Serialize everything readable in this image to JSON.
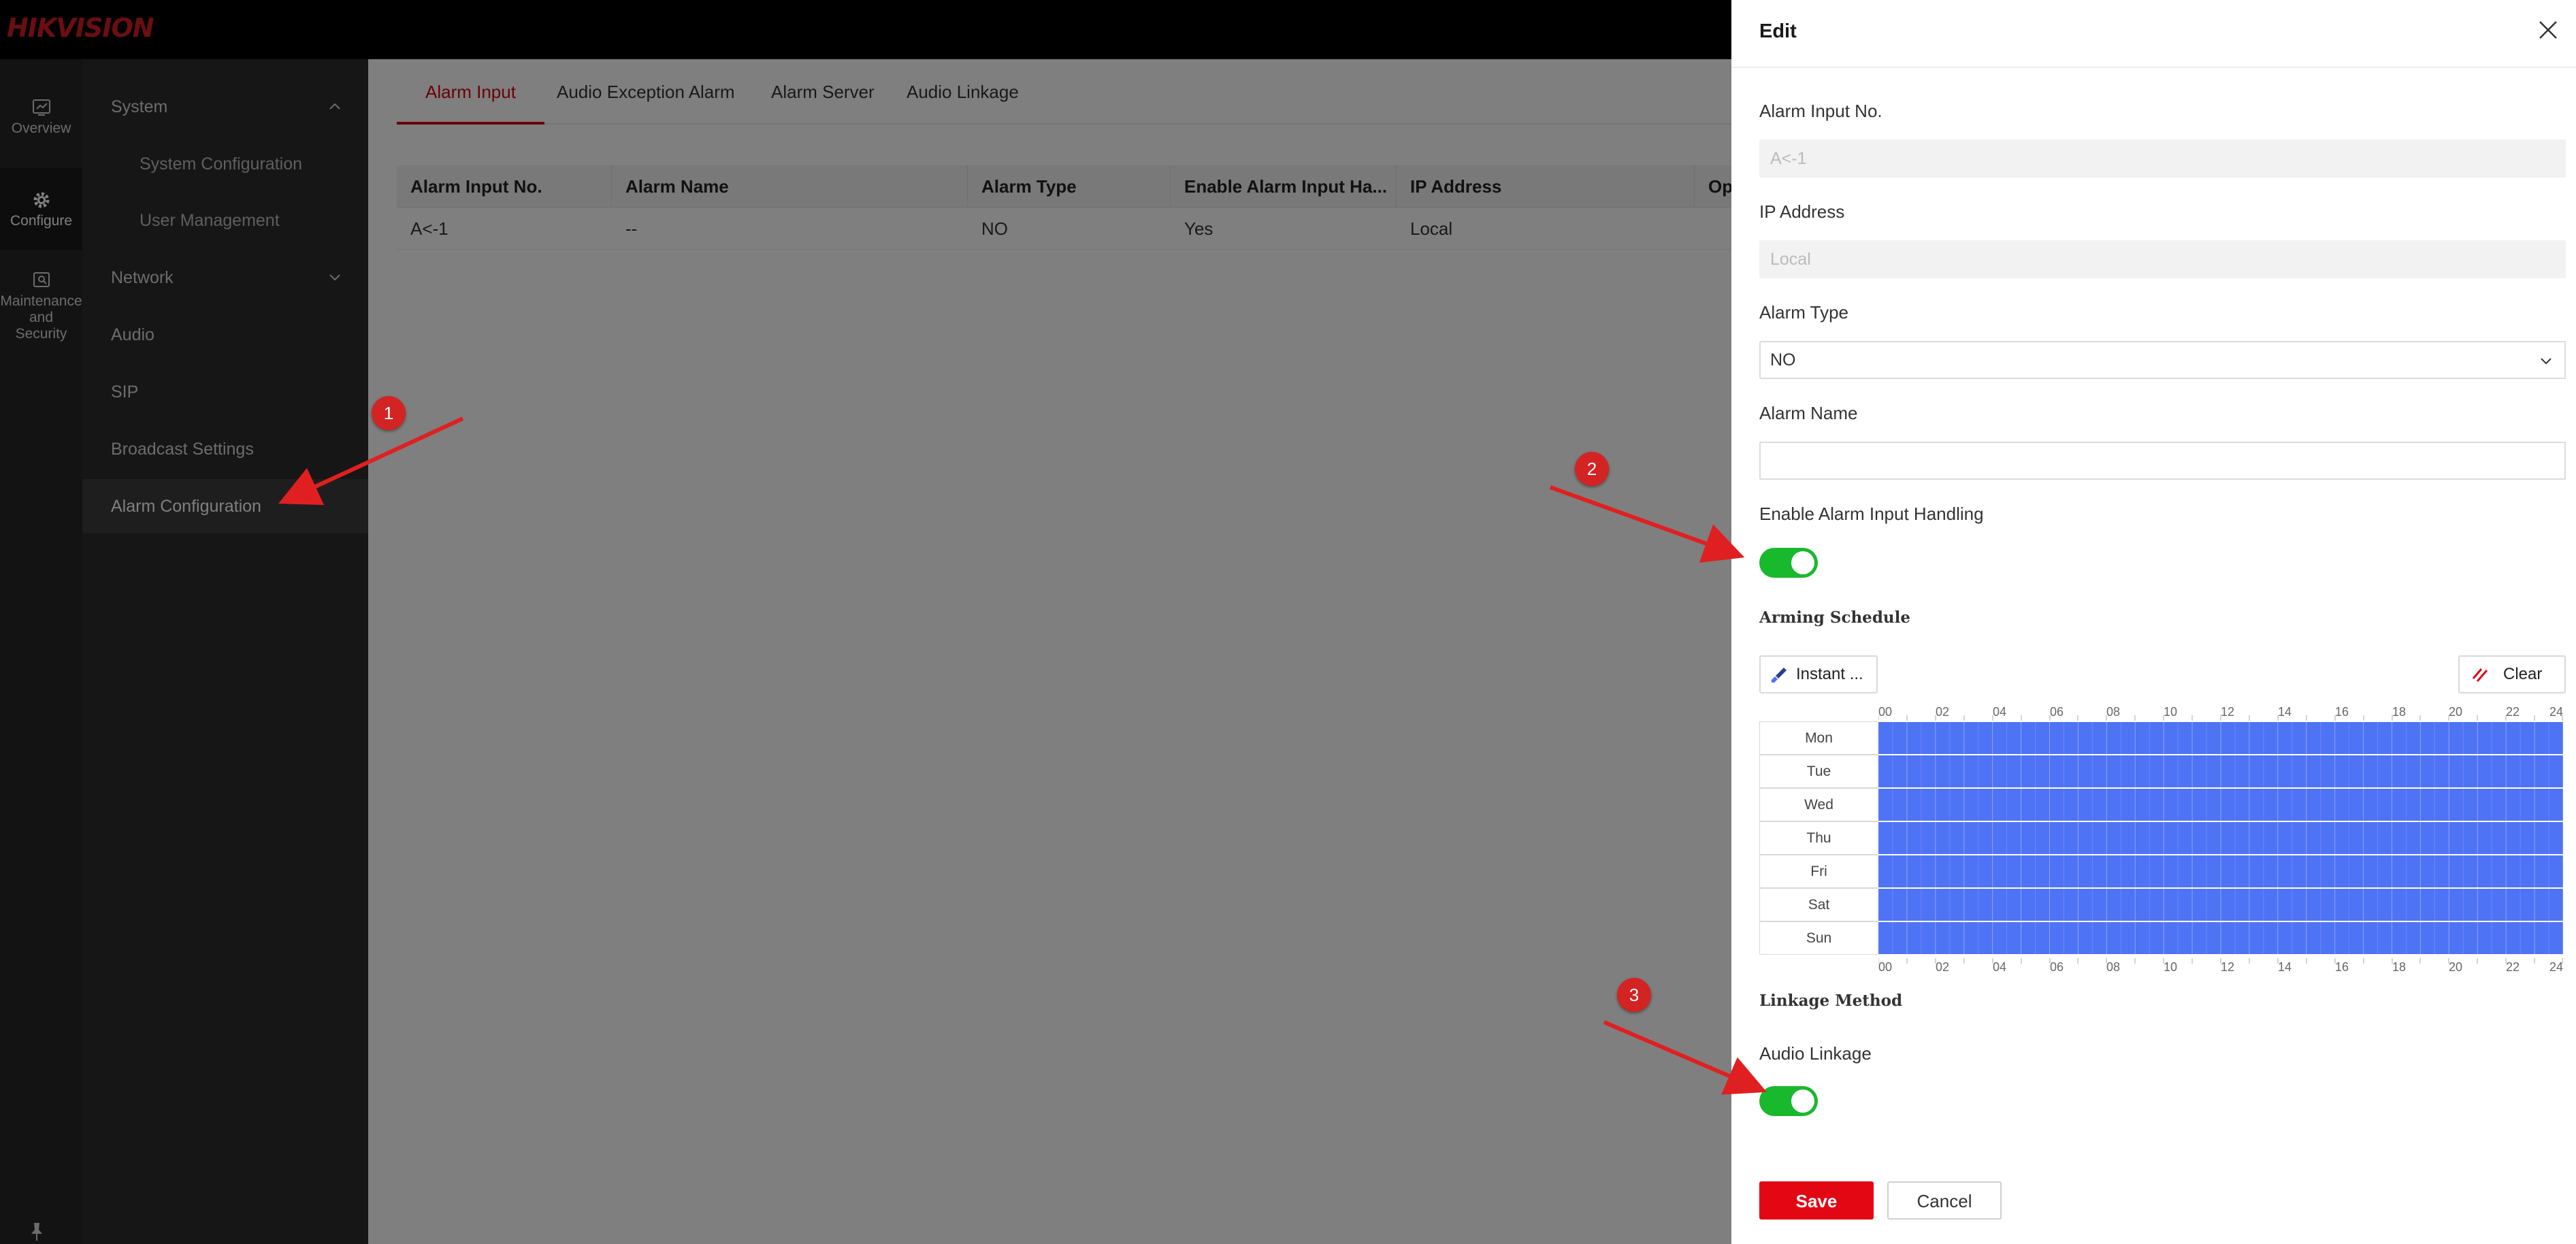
{
  "brand": {
    "logo": "HIKVISION",
    "accent": "#d7000f",
    "toggle_on": "#18b92c",
    "schedule_fill": "#4f73f5"
  },
  "rail": {
    "items": [
      {
        "label": "Overview",
        "icon": "dashboard-icon"
      },
      {
        "label": "Configure",
        "icon": "gear-icon"
      },
      {
        "label": "Maintenance and Security",
        "label_lines": [
          "Maintenance",
          "and",
          "Security"
        ],
        "icon": "maintenance-icon"
      }
    ],
    "pin_icon": "pin-icon"
  },
  "subnav": {
    "items": [
      {
        "label": "System",
        "expanded": true
      },
      {
        "label": "System Configuration",
        "sub": true
      },
      {
        "label": "User Management",
        "sub": true
      },
      {
        "label": "Network",
        "expanded": false
      },
      {
        "label": "Audio"
      },
      {
        "label": "SIP"
      },
      {
        "label": "Broadcast Settings"
      },
      {
        "label": "Alarm Configuration",
        "active": true
      }
    ]
  },
  "tabs": [
    "Alarm Input",
    "Audio Exception Alarm",
    "Alarm Server",
    "Audio Linkage"
  ],
  "active_tab": "Alarm Input",
  "table": {
    "headers": [
      "Alarm Input No.",
      "Alarm Name",
      "Alarm Type",
      "Enable Alarm Input Ha...",
      "IP Address",
      "Op"
    ],
    "rows": [
      [
        "A<-1",
        "--",
        "NO",
        "Yes",
        "Local",
        ""
      ]
    ]
  },
  "drawer": {
    "title": "Edit",
    "alarm_input_no": {
      "label": "Alarm Input No.",
      "value": "A<-1"
    },
    "ip_address": {
      "label": "IP Address",
      "value": "Local"
    },
    "alarm_type": {
      "label": "Alarm Type",
      "value": "NO"
    },
    "alarm_name": {
      "label": "Alarm Name",
      "value": ""
    },
    "enable_handling": {
      "label": "Enable Alarm Input Handling",
      "on": true
    },
    "arming_schedule": {
      "title": "Arming Schedule",
      "instant_label": "Instant ...",
      "clear_label": "Clear",
      "hours": [
        "00",
        "02",
        "04",
        "06",
        "08",
        "10",
        "12",
        "14",
        "16",
        "18",
        "20",
        "22",
        "24"
      ],
      "days": [
        "Mon",
        "Tue",
        "Wed",
        "Thu",
        "Fri",
        "Sat",
        "Sun"
      ],
      "coverage": "all-day"
    },
    "linkage_method": {
      "title": "Linkage Method"
    },
    "audio_linkage": {
      "label": "Audio Linkage",
      "on": true
    },
    "save_label": "Save",
    "cancel_label": "Cancel"
  },
  "annotations": [
    "1",
    "2",
    "3"
  ]
}
